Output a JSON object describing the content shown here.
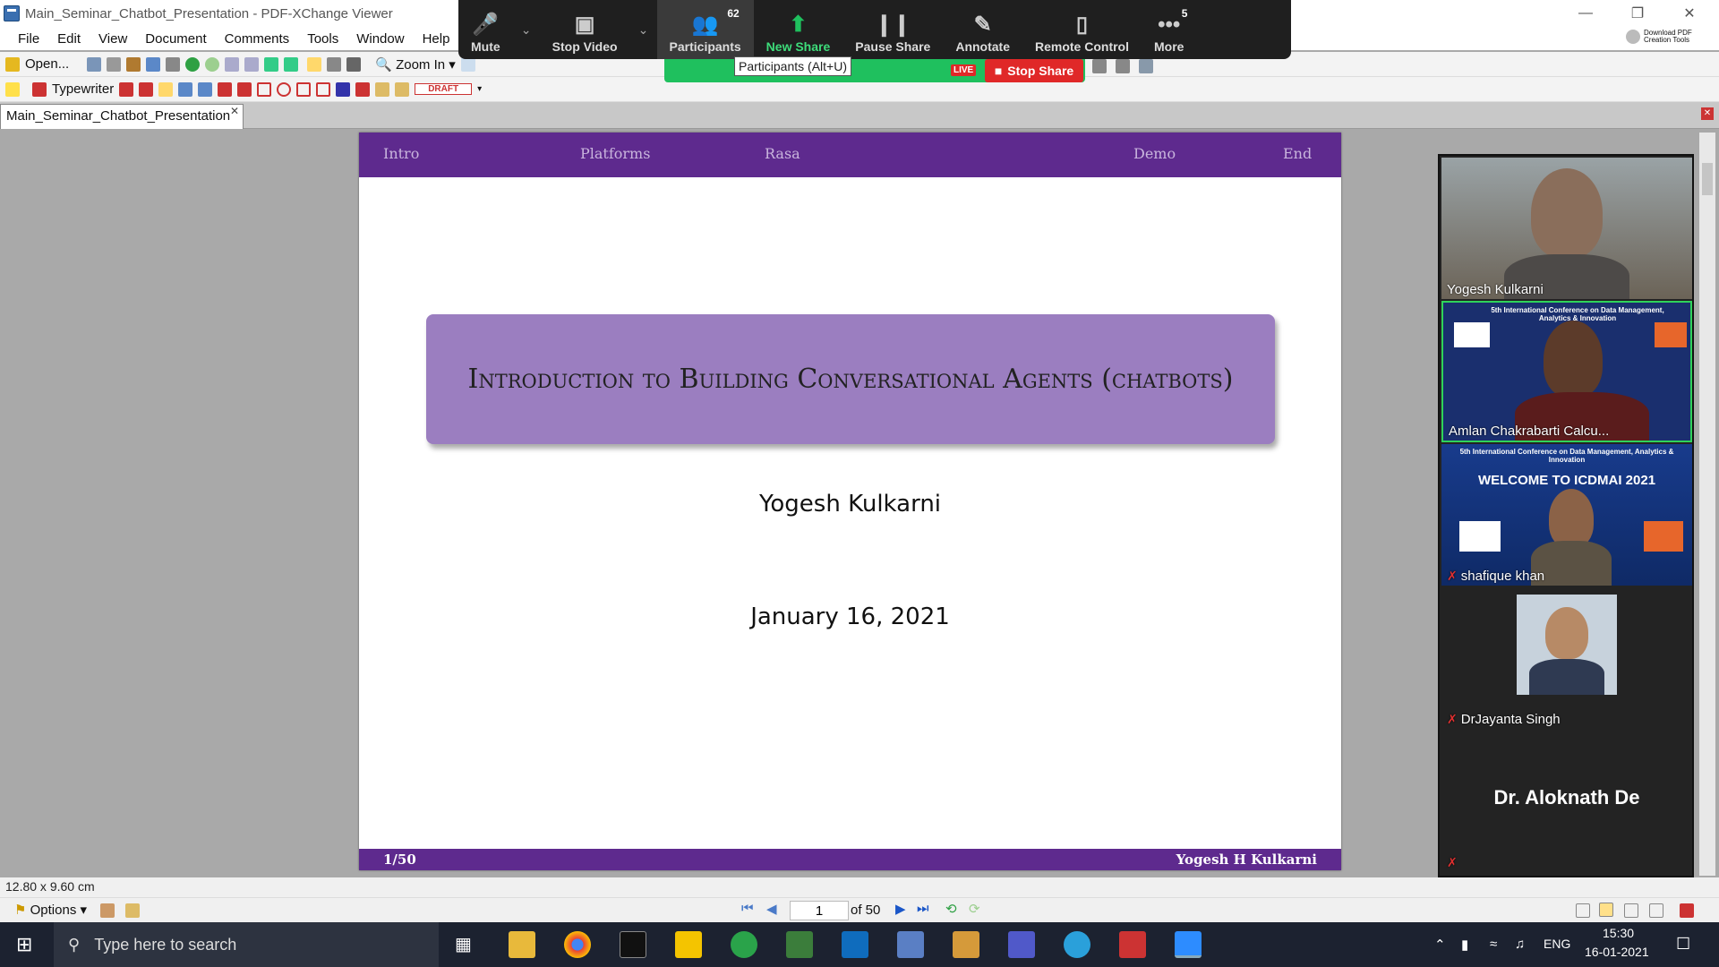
{
  "window": {
    "title": "Main_Seminar_Chatbot_Presentation - PDF-XChange Viewer"
  },
  "menu": [
    "File",
    "Edit",
    "View",
    "Document",
    "Comments",
    "Tools",
    "Window",
    "Help"
  ],
  "toolbar": {
    "open_label": "Open...",
    "zoom_label": "Zoom In",
    "typewriter_label": "Typewriter",
    "draft_label": "DRAFT"
  },
  "zoom": {
    "mute": "Mute",
    "stop_video": "Stop Video",
    "participants": "Participants",
    "participants_count": "62",
    "new_share": "New Share",
    "pause_share": "Pause Share",
    "annotate": "Annotate",
    "remote_control": "Remote Control",
    "more": "More",
    "more_count": "5",
    "stop_share": "Stop Share",
    "live": "LIVE",
    "tooltip": "Participants (Alt+U)"
  },
  "download_tools": "Download PDF Creation Tools",
  "document_tab": "Main_Seminar_Chatbot_Presentation",
  "slide": {
    "nav": [
      "Intro",
      "Platforms",
      "Rasa",
      "Demo",
      "End"
    ],
    "title": "Introduction to Building Conversational Agents (chatbots)",
    "author": "Yogesh Kulkarni",
    "date": "January 16, 2021",
    "page": "1/50",
    "footer_author": "Yogesh H Kulkarni"
  },
  "participants": [
    {
      "name": "Yogesh Kulkarni",
      "muted": false
    },
    {
      "name": "Amlan Chakrabarti Calcu...",
      "muted": false
    },
    {
      "name": "shafique khan",
      "muted": true
    },
    {
      "name": "DrJayanta Singh",
      "muted": true
    },
    {
      "name": "Dr. Aloknath De",
      "muted": true
    }
  ],
  "banner": {
    "conf_line": "5th International Conference on Data Management, Analytics & Innovation",
    "welcome": "WELCOME TO ICDMAI 2021"
  },
  "status": {
    "size": "12.80 x 9.60 cm",
    "page_current": "1",
    "page_of": "of 50",
    "options": "Options"
  },
  "taskbar": {
    "search_placeholder": "Type here to search",
    "lang": "ENG",
    "time": "15:30",
    "date": "16-01-2021"
  },
  "colors": {
    "slide_purple": "#5e2a8e",
    "title_box": "#9b7ec0",
    "zoom_bar": "#1f1f1f",
    "share_green": "#1fc05e",
    "stop_red": "#e02828"
  }
}
